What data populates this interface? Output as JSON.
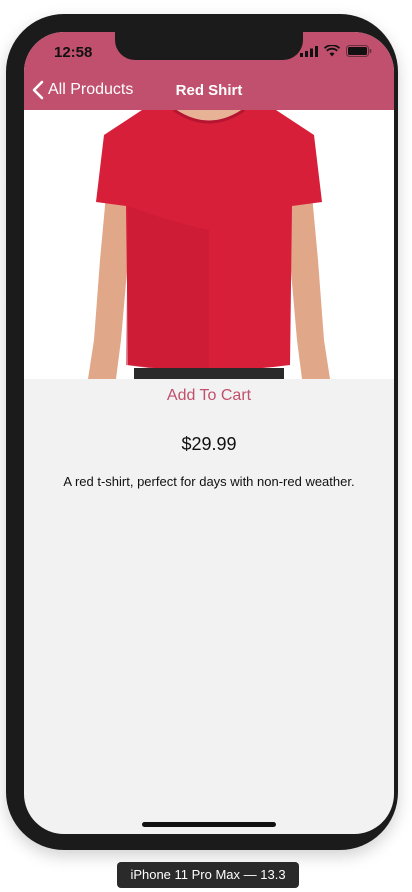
{
  "status_bar": {
    "time": "12:58",
    "icons": [
      "signal-icon",
      "wifi-icon",
      "battery-icon"
    ]
  },
  "nav": {
    "back_label": "All Products",
    "title": "Red Shirt"
  },
  "product": {
    "image_icon": "red-tshirt-photo",
    "add_to_cart_label": "Add To Cart",
    "price": "$29.99",
    "description": "A red t-shirt, perfect for days with non-red weather."
  },
  "simulator": {
    "label": "iPhone 11 Pro Max — 13.3"
  },
  "colors": {
    "accent": "#c0506d",
    "shirt_red": "#d81f3a",
    "background": "#f2f2f2"
  }
}
